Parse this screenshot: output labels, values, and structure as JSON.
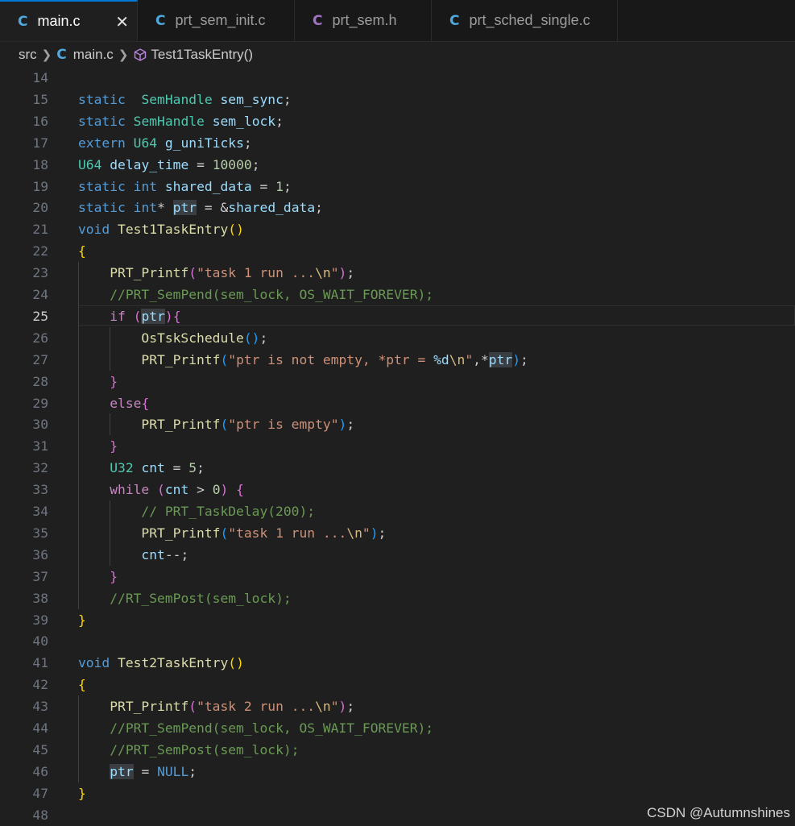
{
  "tabs": [
    {
      "label": "main.c",
      "icon": "C",
      "icon_color": "#4fa9df",
      "active": true
    },
    {
      "label": "prt_sem_init.c",
      "icon": "C",
      "icon_color": "#4fa9df",
      "active": false
    },
    {
      "label": "prt_sem.h",
      "icon": "C",
      "icon_color": "#a074c4",
      "active": false
    },
    {
      "label": "prt_sched_single.c",
      "icon": "C",
      "icon_color": "#4fa9df",
      "active": false
    }
  ],
  "close_glyph": "✕",
  "breadcrumb": {
    "folder": "src",
    "file": "main.c",
    "file_icon": "C",
    "symbol": "Test1TaskEntry()"
  },
  "current_line": 25,
  "lines": [
    {
      "n": "14"
    },
    {
      "n": "15",
      "tokens": [
        [
          "kw",
          "static"
        ],
        [
          "",
          "  "
        ],
        [
          "ty",
          "SemHandle"
        ],
        [
          "",
          " "
        ],
        [
          "var",
          "sem_sync"
        ],
        [
          "",
          ";"
        ]
      ]
    },
    {
      "n": "16",
      "tokens": [
        [
          "kw",
          "static"
        ],
        [
          "",
          " "
        ],
        [
          "ty",
          "SemHandle"
        ],
        [
          "",
          " "
        ],
        [
          "var",
          "sem_lock"
        ],
        [
          "",
          ";"
        ]
      ]
    },
    {
      "n": "17",
      "tokens": [
        [
          "kw",
          "extern"
        ],
        [
          "",
          " "
        ],
        [
          "ty",
          "U64"
        ],
        [
          "",
          " "
        ],
        [
          "var",
          "g_uniTicks"
        ],
        [
          "",
          ";"
        ]
      ]
    },
    {
      "n": "18",
      "tokens": [
        [
          "ty",
          "U64"
        ],
        [
          "",
          " "
        ],
        [
          "var",
          "delay_time"
        ],
        [
          "",
          " = "
        ],
        [
          "num",
          "10000"
        ],
        [
          "",
          ";"
        ]
      ]
    },
    {
      "n": "19",
      "tokens": [
        [
          "kw",
          "static"
        ],
        [
          "",
          " "
        ],
        [
          "kw",
          "int"
        ],
        [
          "",
          " "
        ],
        [
          "var",
          "shared_data"
        ],
        [
          "",
          " = "
        ],
        [
          "num",
          "1"
        ],
        [
          "",
          ";"
        ]
      ]
    },
    {
      "n": "20",
      "tokens": [
        [
          "kw",
          "static"
        ],
        [
          "",
          " "
        ],
        [
          "kw",
          "int"
        ],
        [
          "",
          "* "
        ],
        [
          "var hl",
          "ptr"
        ],
        [
          "",
          " = &"
        ],
        [
          "var",
          "shared_data"
        ],
        [
          "",
          ";"
        ]
      ]
    },
    {
      "n": "21",
      "tokens": [
        [
          "kw",
          "void"
        ],
        [
          "",
          " "
        ],
        [
          "fn",
          "Test1TaskEntry"
        ],
        [
          "b1",
          "()"
        ]
      ]
    },
    {
      "n": "22",
      "tokens": [
        [
          "b1",
          "{"
        ]
      ]
    },
    {
      "n": "23",
      "guides": [
        1
      ],
      "tokens": [
        [
          "",
          "    "
        ],
        [
          "fn",
          "PRT_Printf"
        ],
        [
          "b2",
          "("
        ],
        [
          "str",
          "\"task 1 run ..."
        ],
        [
          "esc",
          "\\n"
        ],
        [
          "str",
          "\""
        ],
        [
          "b2",
          ")"
        ],
        [
          "",
          ";"
        ]
      ]
    },
    {
      "n": "24",
      "guides": [
        1
      ],
      "tokens": [
        [
          "",
          "    "
        ],
        [
          "cmt",
          "//PRT_SemPend(sem_lock, OS_WAIT_FOREVER);"
        ]
      ]
    },
    {
      "n": "25",
      "guides": [
        1
      ],
      "tokens": [
        [
          "",
          "    "
        ],
        [
          "ctl",
          "if"
        ],
        [
          "",
          " "
        ],
        [
          "b2",
          "("
        ],
        [
          "var hl",
          "ptr"
        ],
        [
          "b2",
          ")"
        ],
        [
          "b2",
          "{"
        ]
      ]
    },
    {
      "n": "26",
      "guides": [
        1,
        2
      ],
      "tokens": [
        [
          "",
          "        "
        ],
        [
          "fn",
          "OsTskSchedule"
        ],
        [
          "b3",
          "()"
        ],
        [
          "",
          ";"
        ]
      ]
    },
    {
      "n": "27",
      "guides": [
        1,
        2
      ],
      "tokens": [
        [
          "",
          "        "
        ],
        [
          "fn",
          "PRT_Printf"
        ],
        [
          "b3",
          "("
        ],
        [
          "str",
          "\"ptr is not empty, *ptr = "
        ],
        [
          "fmt",
          "%d"
        ],
        [
          "esc",
          "\\n"
        ],
        [
          "str",
          "\""
        ],
        [
          "",
          ",*"
        ],
        [
          "var hl",
          "ptr"
        ],
        [
          "b3",
          ")"
        ],
        [
          "",
          ";"
        ]
      ]
    },
    {
      "n": "28",
      "guides": [
        1
      ],
      "tokens": [
        [
          "",
          "    "
        ],
        [
          "b2",
          "}"
        ]
      ]
    },
    {
      "n": "29",
      "guides": [
        1
      ],
      "tokens": [
        [
          "",
          "    "
        ],
        [
          "ctl",
          "else"
        ],
        [
          "b2",
          "{"
        ]
      ]
    },
    {
      "n": "30",
      "guides": [
        1,
        2
      ],
      "tokens": [
        [
          "",
          "        "
        ],
        [
          "fn",
          "PRT_Printf"
        ],
        [
          "b3",
          "("
        ],
        [
          "str",
          "\"ptr is empty\""
        ],
        [
          "b3",
          ")"
        ],
        [
          "",
          ";"
        ]
      ]
    },
    {
      "n": "31",
      "guides": [
        1
      ],
      "tokens": [
        [
          "",
          "    "
        ],
        [
          "b2",
          "}"
        ]
      ]
    },
    {
      "n": "32",
      "guides": [
        1
      ],
      "tokens": [
        [
          "",
          "    "
        ],
        [
          "ty",
          "U32"
        ],
        [
          "",
          " "
        ],
        [
          "var",
          "cnt"
        ],
        [
          "",
          " = "
        ],
        [
          "num",
          "5"
        ],
        [
          "",
          ";"
        ]
      ]
    },
    {
      "n": "33",
      "guides": [
        1
      ],
      "tokens": [
        [
          "",
          "    "
        ],
        [
          "ctl",
          "while"
        ],
        [
          "",
          " "
        ],
        [
          "b2",
          "("
        ],
        [
          "var",
          "cnt"
        ],
        [
          "",
          " > "
        ],
        [
          "num",
          "0"
        ],
        [
          "b2",
          ")"
        ],
        [
          "",
          " "
        ],
        [
          "b2",
          "{"
        ]
      ]
    },
    {
      "n": "34",
      "guides": [
        1,
        2
      ],
      "tokens": [
        [
          "",
          "        "
        ],
        [
          "cmt",
          "// PRT_TaskDelay(200);"
        ]
      ]
    },
    {
      "n": "35",
      "guides": [
        1,
        2
      ],
      "tokens": [
        [
          "",
          "        "
        ],
        [
          "fn",
          "PRT_Printf"
        ],
        [
          "b3",
          "("
        ],
        [
          "str",
          "\"task 1 run ..."
        ],
        [
          "esc",
          "\\n"
        ],
        [
          "str",
          "\""
        ],
        [
          "b3",
          ")"
        ],
        [
          "",
          ";"
        ]
      ]
    },
    {
      "n": "36",
      "guides": [
        1,
        2
      ],
      "tokens": [
        [
          "",
          "        "
        ],
        [
          "var",
          "cnt"
        ],
        [
          "",
          "--;"
        ]
      ]
    },
    {
      "n": "37",
      "guides": [
        1
      ],
      "tokens": [
        [
          "",
          "    "
        ],
        [
          "b2",
          "}"
        ]
      ]
    },
    {
      "n": "38",
      "guides": [
        1
      ],
      "tokens": [
        [
          "",
          "    "
        ],
        [
          "cmt",
          "//RT_SemPost(sem_lock);"
        ]
      ]
    },
    {
      "n": "39",
      "tokens": [
        [
          "b1",
          "}"
        ]
      ]
    },
    {
      "n": "40"
    },
    {
      "n": "41",
      "tokens": [
        [
          "kw",
          "void"
        ],
        [
          "",
          " "
        ],
        [
          "fn",
          "Test2TaskEntry"
        ],
        [
          "b1",
          "()"
        ]
      ]
    },
    {
      "n": "42",
      "tokens": [
        [
          "b1",
          "{"
        ]
      ]
    },
    {
      "n": "43",
      "guides": [
        1
      ],
      "tokens": [
        [
          "",
          "    "
        ],
        [
          "fn",
          "PRT_Printf"
        ],
        [
          "b2",
          "("
        ],
        [
          "str",
          "\"task 2 run ..."
        ],
        [
          "esc",
          "\\n"
        ],
        [
          "str",
          "\""
        ],
        [
          "b2",
          ")"
        ],
        [
          "",
          ";"
        ]
      ]
    },
    {
      "n": "44",
      "guides": [
        1
      ],
      "tokens": [
        [
          "",
          "    "
        ],
        [
          "cmt",
          "//PRT_SemPend(sem_lock, OS_WAIT_FOREVER);"
        ]
      ]
    },
    {
      "n": "45",
      "guides": [
        1
      ],
      "tokens": [
        [
          "",
          "    "
        ],
        [
          "cmt",
          "//PRT_SemPost(sem_lock);"
        ]
      ]
    },
    {
      "n": "46",
      "guides": [
        1
      ],
      "tokens": [
        [
          "",
          "    "
        ],
        [
          "var hl",
          "ptr"
        ],
        [
          "",
          " = "
        ],
        [
          "kw",
          "NULL"
        ],
        [
          "",
          ";"
        ]
      ]
    },
    {
      "n": "47",
      "tokens": [
        [
          "b1",
          "}"
        ]
      ]
    },
    {
      "n": "48"
    }
  ],
  "watermark": "CSDN @Autumnshines"
}
